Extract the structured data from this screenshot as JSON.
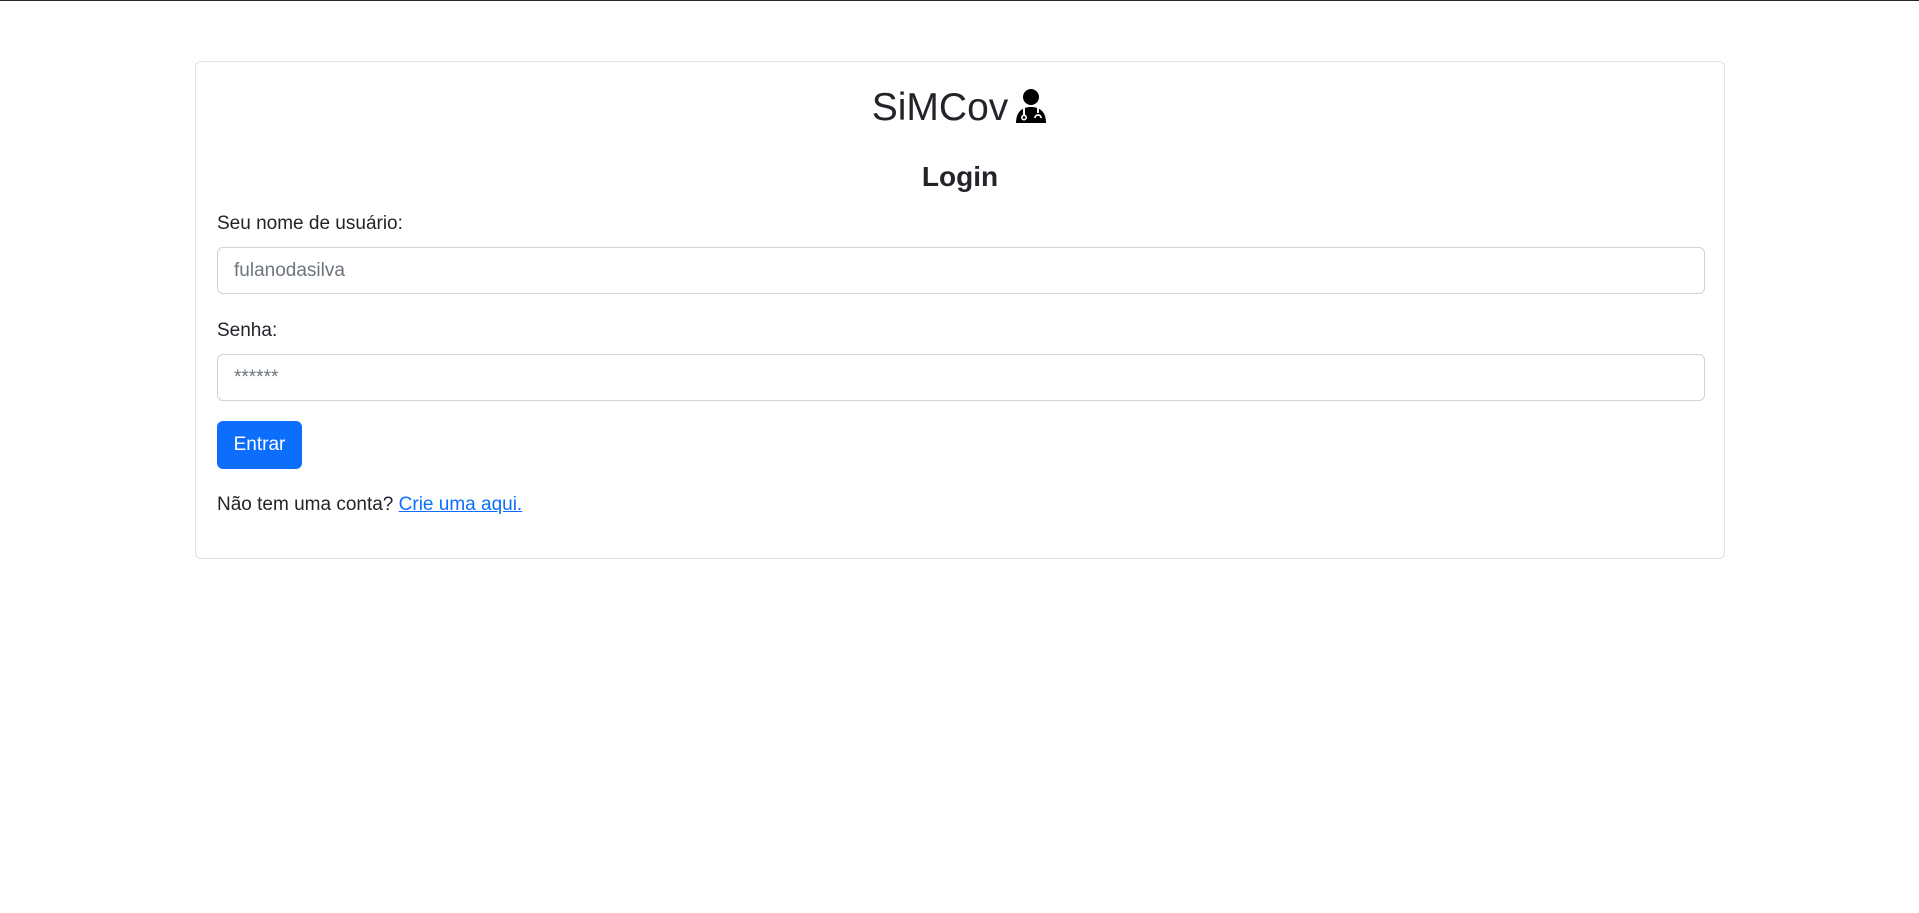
{
  "app": {
    "brand_title": "SiMCov",
    "brand_icon": "user-doctor-icon"
  },
  "login": {
    "heading": "Login",
    "username": {
      "label": "Seu nome de usuário:",
      "placeholder": "fulanodasilva",
      "value": ""
    },
    "password": {
      "label": "Senha:",
      "placeholder": "******",
      "value": ""
    },
    "submit_label": "Entrar",
    "signup_prompt": "Não tem uma conta?",
    "signup_link": "Crie uma aqui."
  },
  "colors": {
    "primary": "#0d6efd",
    "text": "#212529",
    "border": "#dee2e6",
    "placeholder": "#6c757d"
  }
}
